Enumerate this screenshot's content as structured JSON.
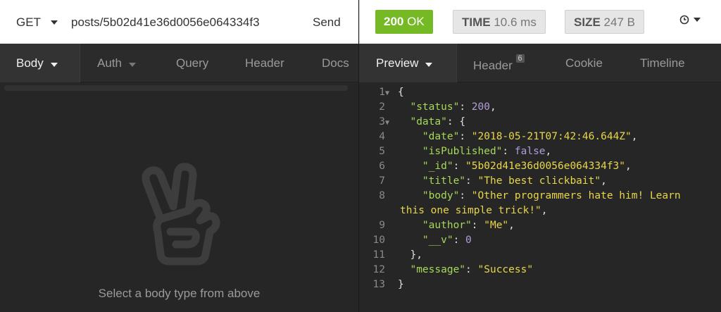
{
  "request": {
    "method": "GET",
    "url_visible": "posts/5b02d41e36d0056e064334f3",
    "send_label": "Send",
    "tabs": [
      {
        "label": "Body"
      },
      {
        "label": "Auth"
      },
      {
        "label": "Query"
      },
      {
        "label": "Header"
      },
      {
        "label": "Docs"
      }
    ],
    "body_hint": "Select a body type from above",
    "body_icon": "peace-hand-icon"
  },
  "response": {
    "status_code": "200",
    "status_text": "OK",
    "time_label": "TIME",
    "time_value": "10.6 ms",
    "size_label": "SIZE",
    "size_value": "247 B",
    "history_icon": "clock-icon",
    "tabs": [
      {
        "label": "Preview"
      },
      {
        "label": "Header",
        "count": "6"
      },
      {
        "label": "Cookie"
      },
      {
        "label": "Timeline"
      }
    ],
    "lines": [
      {
        "n": "1",
        "fold": true
      },
      {
        "n": "2"
      },
      {
        "n": "3",
        "fold": true
      },
      {
        "n": "4"
      },
      {
        "n": "5"
      },
      {
        "n": "6"
      },
      {
        "n": "7"
      },
      {
        "n": "8"
      },
      {
        "n": ""
      },
      {
        "n": "9"
      },
      {
        "n": "10"
      },
      {
        "n": "11"
      },
      {
        "n": "12"
      },
      {
        "n": "13"
      }
    ],
    "json": {
      "status_key": "\"status\"",
      "status_val": "200",
      "data_key": "\"data\"",
      "date_key": "\"date\"",
      "date_val": "\"2018-05-21T07:42:46.644Z\"",
      "published_key": "\"isPublished\"",
      "published_val": "false",
      "id_key": "\"_id\"",
      "id_val": "\"5b02d41e36d0056e064334f3\"",
      "title_key": "\"title\"",
      "title_val": "\"The best clickbait\"",
      "body_key": "\"body\"",
      "body_val_1": "\"Other programmers hate him! Learn",
      "body_val_2": "this one simple trick!\"",
      "author_key": "\"author\"",
      "author_val": "\"Me\"",
      "v_key": "\"__v\"",
      "v_val": "0",
      "message_key": "\"message\"",
      "message_val": "\"Success\""
    }
  },
  "colors": {
    "status_ok": "#75ba24",
    "json_key": "#a6d95a",
    "json_string": "#e8d64a",
    "json_number": "#b39ddb"
  }
}
